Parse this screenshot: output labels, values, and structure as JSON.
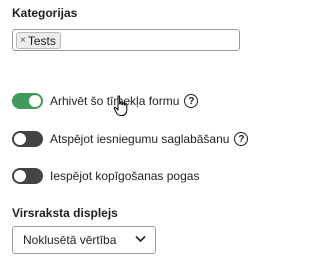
{
  "categories": {
    "label": "Kategorijas",
    "tags": [
      {
        "text": "Tests",
        "remove_glyph": "×"
      }
    ]
  },
  "toggles": [
    {
      "label": "Arhivēt šo tīmekļa formu",
      "state": "on",
      "has_help": true
    },
    {
      "label": "Atspējot iesniegumu saglabāšanu",
      "state": "off",
      "has_help": true
    },
    {
      "label": "Iespējot kopīgošanas pogas",
      "state": "off",
      "has_help": false
    }
  ],
  "help_glyph": "?",
  "header_display": {
    "label": "Virsraksta displejs",
    "selected": "Noklusētā vērtība"
  },
  "colors": {
    "toggle_on": "#3f9b5c",
    "toggle_off": "#444444"
  },
  "icons": {
    "tag_remove": "close-icon",
    "help": "question-circle-icon",
    "select": "chevron-down-icon",
    "cursor": "hand-pointer-cursor"
  }
}
